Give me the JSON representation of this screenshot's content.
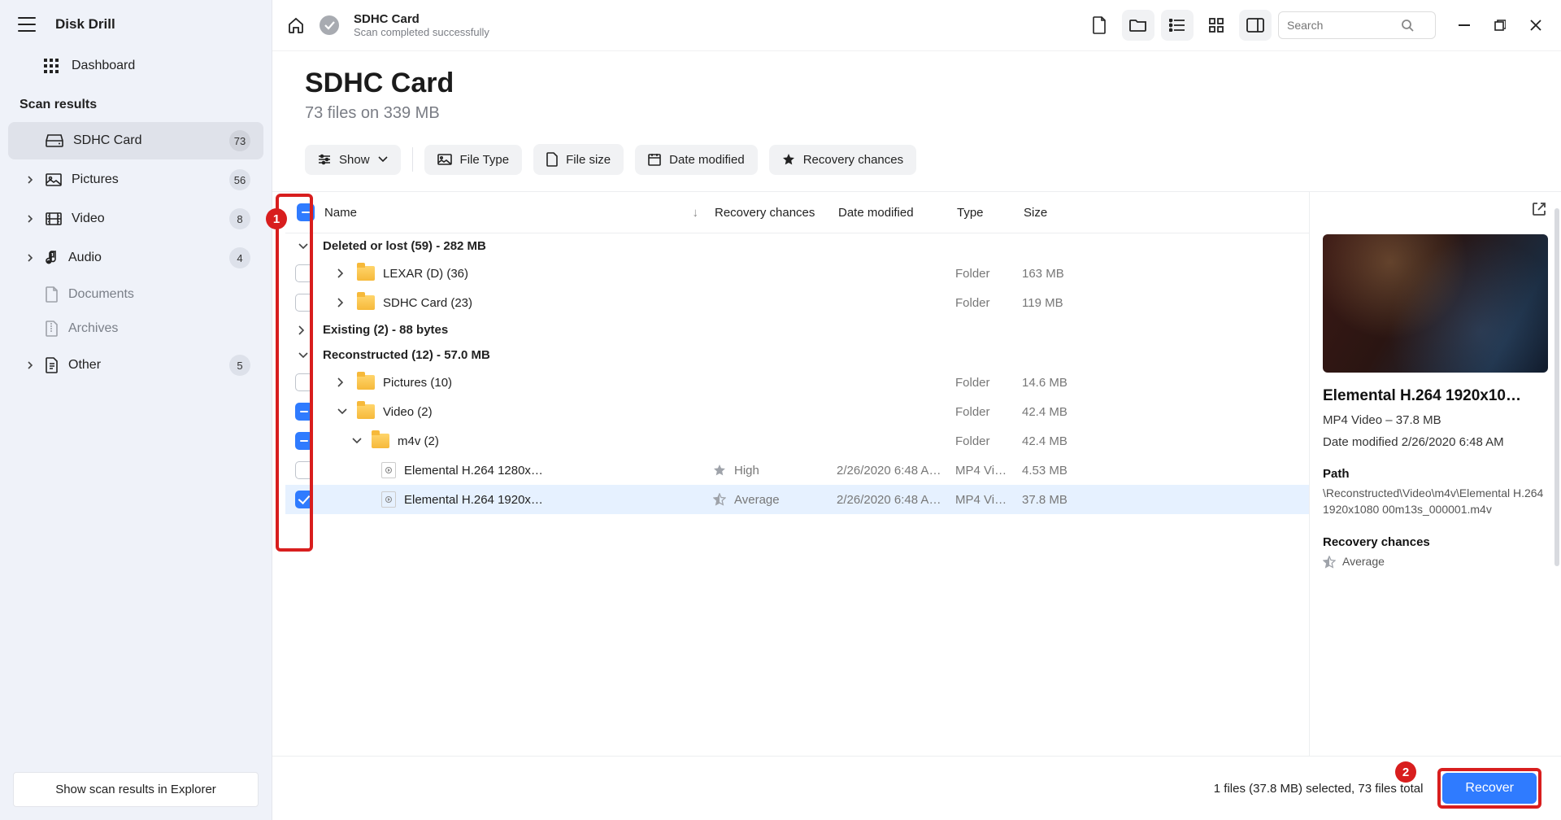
{
  "app": {
    "title": "Disk Drill"
  },
  "sidebar": {
    "dashboard": "Dashboard",
    "section": "Scan results",
    "items": [
      {
        "label": "SDHC Card",
        "count": "73",
        "icon": "disk"
      },
      {
        "label": "Pictures",
        "count": "56",
        "icon": "image"
      },
      {
        "label": "Video",
        "count": "8",
        "icon": "video"
      },
      {
        "label": "Audio",
        "count": "4",
        "icon": "audio"
      },
      {
        "label": "Documents",
        "count": "",
        "icon": "doc"
      },
      {
        "label": "Archives",
        "count": "",
        "icon": "archive"
      },
      {
        "label": "Other",
        "count": "5",
        "icon": "other"
      }
    ],
    "footer": "Show scan results in Explorer"
  },
  "titlebar": {
    "title": "SDHC Card",
    "subtitle": "Scan completed successfully",
    "search_placeholder": "Search"
  },
  "page": {
    "title": "SDHC Card",
    "subtitle": "73 files on 339 MB"
  },
  "filters": {
    "show": "Show",
    "file_type": "File Type",
    "file_size": "File size",
    "date_modified": "Date modified",
    "recovery_chances": "Recovery chances"
  },
  "columns": {
    "name": "Name",
    "recovery": "Recovery chances",
    "date": "Date modified",
    "type": "Type",
    "size": "Size"
  },
  "rows": {
    "g1": "Deleted or lost (59) - 282 MB",
    "r1_name": "LEXAR (D) (36)",
    "r1_type": "Folder",
    "r1_size": "163 MB",
    "r2_name": "SDHC Card (23)",
    "r2_type": "Folder",
    "r2_size": "119 MB",
    "g2": "Existing (2) - 88 bytes",
    "g3": "Reconstructed (12) - 57.0 MB",
    "r3_name": "Pictures (10)",
    "r3_type": "Folder",
    "r3_size": "14.6 MB",
    "r4_name": "Video (2)",
    "r4_type": "Folder",
    "r4_size": "42.4 MB",
    "r5_name": "m4v (2)",
    "r5_type": "Folder",
    "r5_size": "42.4 MB",
    "r6_name": "Elemental H.264 1280x…",
    "r6_rec": "High",
    "r6_date": "2/26/2020 6:48 A…",
    "r6_type": "MP4 Vi…",
    "r6_size": "4.53 MB",
    "r7_name": "Elemental H.264 1920x…",
    "r7_rec": "Average",
    "r7_date": "2/26/2020 6:48 A…",
    "r7_type": "MP4 Vi…",
    "r7_size": "37.8 MB"
  },
  "preview": {
    "title": "Elemental H.264 1920x10…",
    "line1": "MP4 Video – 37.8 MB",
    "line2": "Date modified 2/26/2020 6:48 AM",
    "path_label": "Path",
    "path_value": "\\Reconstructed\\Video\\m4v\\Elemental H.264 1920x1080 00m13s_000001.m4v",
    "rc_label": "Recovery chances",
    "rc_value": "Average"
  },
  "status": {
    "text": "1 files (37.8 MB) selected, 73 files total",
    "recover": "Recover"
  },
  "markers": {
    "m1": "1",
    "m2": "2"
  }
}
